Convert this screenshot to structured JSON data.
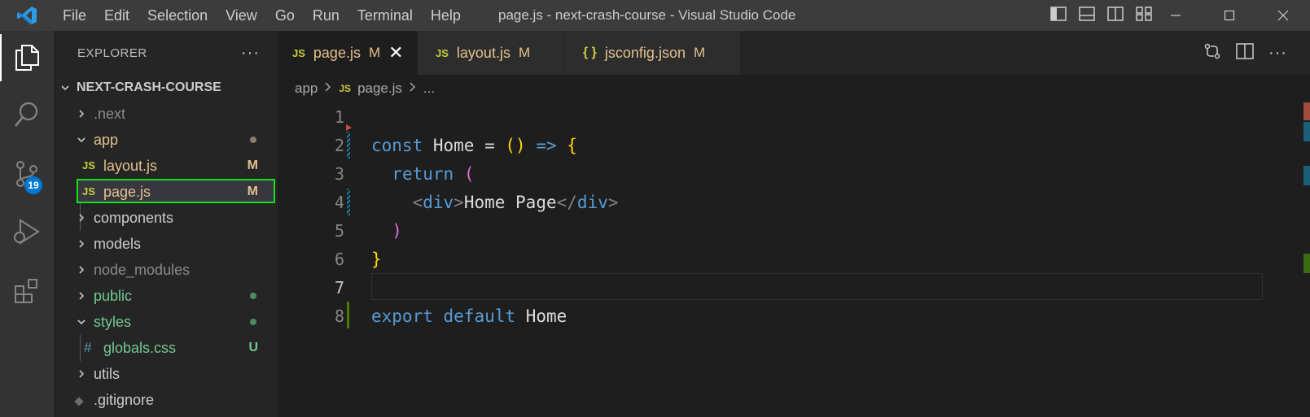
{
  "titlebar": {
    "menu": [
      "File",
      "Edit",
      "Selection",
      "View",
      "Go",
      "Run",
      "Terminal",
      "Help"
    ],
    "window_title": "page.js - next-crash-course - Visual Studio Code"
  },
  "activitybar": {
    "items": [
      "explorer-icon",
      "search-icon",
      "source-control-icon",
      "run-debug-icon",
      "extensions-icon"
    ],
    "scm_badge": "19"
  },
  "sidebar": {
    "title": "EXPLORER",
    "more": "···",
    "project": "NEXT-CRASH-COURSE",
    "tree": [
      {
        "label": ".next",
        "type": "folder",
        "expanded": false,
        "depth": 0,
        "color": "#8b8b8b"
      },
      {
        "label": "app",
        "type": "folder",
        "expanded": true,
        "depth": 0,
        "color": "#e2c08d",
        "dot": "#8b7e68"
      },
      {
        "label": "layout.js",
        "type": "js",
        "depth": 1,
        "color": "#e2c08d",
        "status": "M"
      },
      {
        "label": "page.js",
        "type": "js",
        "depth": 1,
        "color": "#e2c08d",
        "status": "M",
        "selected": true
      },
      {
        "label": "components",
        "type": "folder",
        "expanded": false,
        "depth": 0,
        "color": "#cccccc"
      },
      {
        "label": "models",
        "type": "folder",
        "expanded": false,
        "depth": 0,
        "color": "#cccccc"
      },
      {
        "label": "node_modules",
        "type": "folder",
        "expanded": false,
        "depth": 0,
        "color": "#8b8b8b"
      },
      {
        "label": "public",
        "type": "folder",
        "expanded": false,
        "depth": 0,
        "color": "#73c991",
        "dot": "#4f8a62"
      },
      {
        "label": "styles",
        "type": "folder",
        "expanded": true,
        "depth": 0,
        "color": "#73c991",
        "dot": "#4f8a62"
      },
      {
        "label": "globals.css",
        "type": "css",
        "depth": 1,
        "color": "#73c991",
        "status": "U"
      },
      {
        "label": "utils",
        "type": "folder",
        "expanded": false,
        "depth": 0,
        "color": "#cccccc"
      },
      {
        "label": ".gitignore",
        "type": "git",
        "depth": 0,
        "color": "#cccccc"
      }
    ]
  },
  "tabs": [
    {
      "label": "page.js",
      "icon": "JS",
      "status": "M",
      "active": true,
      "close": "✕"
    },
    {
      "label": "layout.js",
      "icon": "JS",
      "status": "M",
      "active": false
    },
    {
      "label": "jsconfig.json",
      "icon": "{ }",
      "status": "M",
      "active": false
    }
  ],
  "breadcrumb": {
    "folder": "app",
    "file_icon": "JS",
    "file": "page.js",
    "more": "..."
  },
  "editor": {
    "active_line": 7,
    "lines": [
      {
        "n": "1",
        "tokens": []
      },
      {
        "n": "2",
        "tokens": [
          [
            "const",
            "kw"
          ],
          [
            " ",
            ""
          ],
          [
            "Home",
            "ident"
          ],
          [
            " = ",
            ""
          ],
          [
            "()",
            "br1"
          ],
          [
            " ",
            ""
          ],
          [
            "=>",
            "kw"
          ],
          [
            " ",
            ""
          ],
          [
            "{",
            "br1"
          ]
        ]
      },
      {
        "n": "3",
        "tokens": [
          [
            "  ",
            ""
          ],
          [
            "return",
            "kw"
          ],
          [
            " ",
            ""
          ],
          [
            "(",
            "br2"
          ]
        ]
      },
      {
        "n": "4",
        "tokens": [
          [
            "    ",
            ""
          ],
          [
            "<",
            "punct"
          ],
          [
            "div",
            "tag"
          ],
          [
            ">",
            "punct"
          ],
          [
            "Home Page",
            "ident"
          ],
          [
            "</",
            "punct"
          ],
          [
            "div",
            "tag"
          ],
          [
            ">",
            "punct"
          ]
        ]
      },
      {
        "n": "5",
        "tokens": [
          [
            "  ",
            ""
          ],
          [
            ")",
            "br2"
          ]
        ]
      },
      {
        "n": "6",
        "tokens": [
          [
            "}",
            "br1"
          ]
        ]
      },
      {
        "n": "7",
        "tokens": []
      },
      {
        "n": "8",
        "tokens": [
          [
            "export",
            "kw"
          ],
          [
            " ",
            ""
          ],
          [
            "default",
            "kw"
          ],
          [
            " ",
            ""
          ],
          [
            "Home",
            "ident"
          ]
        ]
      }
    ]
  },
  "colors": {
    "accent": "#0078d4",
    "modified": "#e2c08d",
    "untracked": "#73c991",
    "selection_highlight": "#18e018"
  }
}
